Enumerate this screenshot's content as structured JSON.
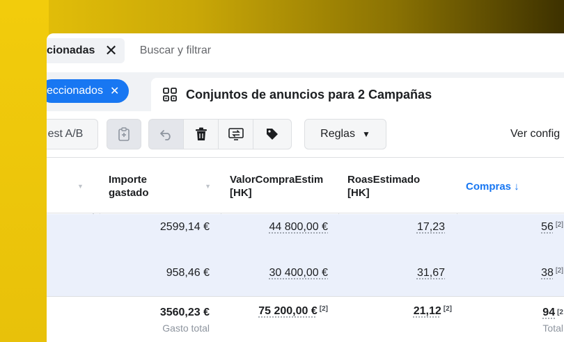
{
  "filterbar": {
    "chip_label": "cionadas",
    "search_placeholder": "Buscar y filtrar"
  },
  "tabs": {
    "selected_pill": "eccionados",
    "active_tab": "Conjuntos de anuncios para 2 Campañas"
  },
  "toolbar": {
    "test_ab": "est A/B",
    "reglas": "Reglas",
    "ver_config": "Ver config"
  },
  "table": {
    "headers": {
      "importe": "Importe\ngastado",
      "valor": "ValorCompraEstim\n[HK]",
      "roas": "RoasEstimado\n[HK]",
      "compras": "Compras ↓"
    },
    "rows": [
      {
        "importe": "2599,14 €",
        "valor": "44 800,00 €",
        "roas": "17,23",
        "compras": "56",
        "compras_note": "[2]"
      },
      {
        "importe": "958,46 €",
        "valor": "30 400,00 €",
        "roas": "31,67",
        "compras": "38",
        "compras_note": "[2]"
      }
    ],
    "totals": {
      "importe": "3560,23 €",
      "importe_sub": "Gasto total",
      "valor": "75 200,00 €",
      "valor_note": "[2]",
      "roas": "21,12",
      "roas_note": "[2]",
      "compras": "94",
      "compras_note": "[2",
      "compras_sub": "Total"
    }
  },
  "colors": {
    "accent": "#1877f2",
    "selected_row": "#ebf0fb",
    "background_gradient_start": "#e9c40a",
    "background_gradient_end": "#3d3100"
  }
}
